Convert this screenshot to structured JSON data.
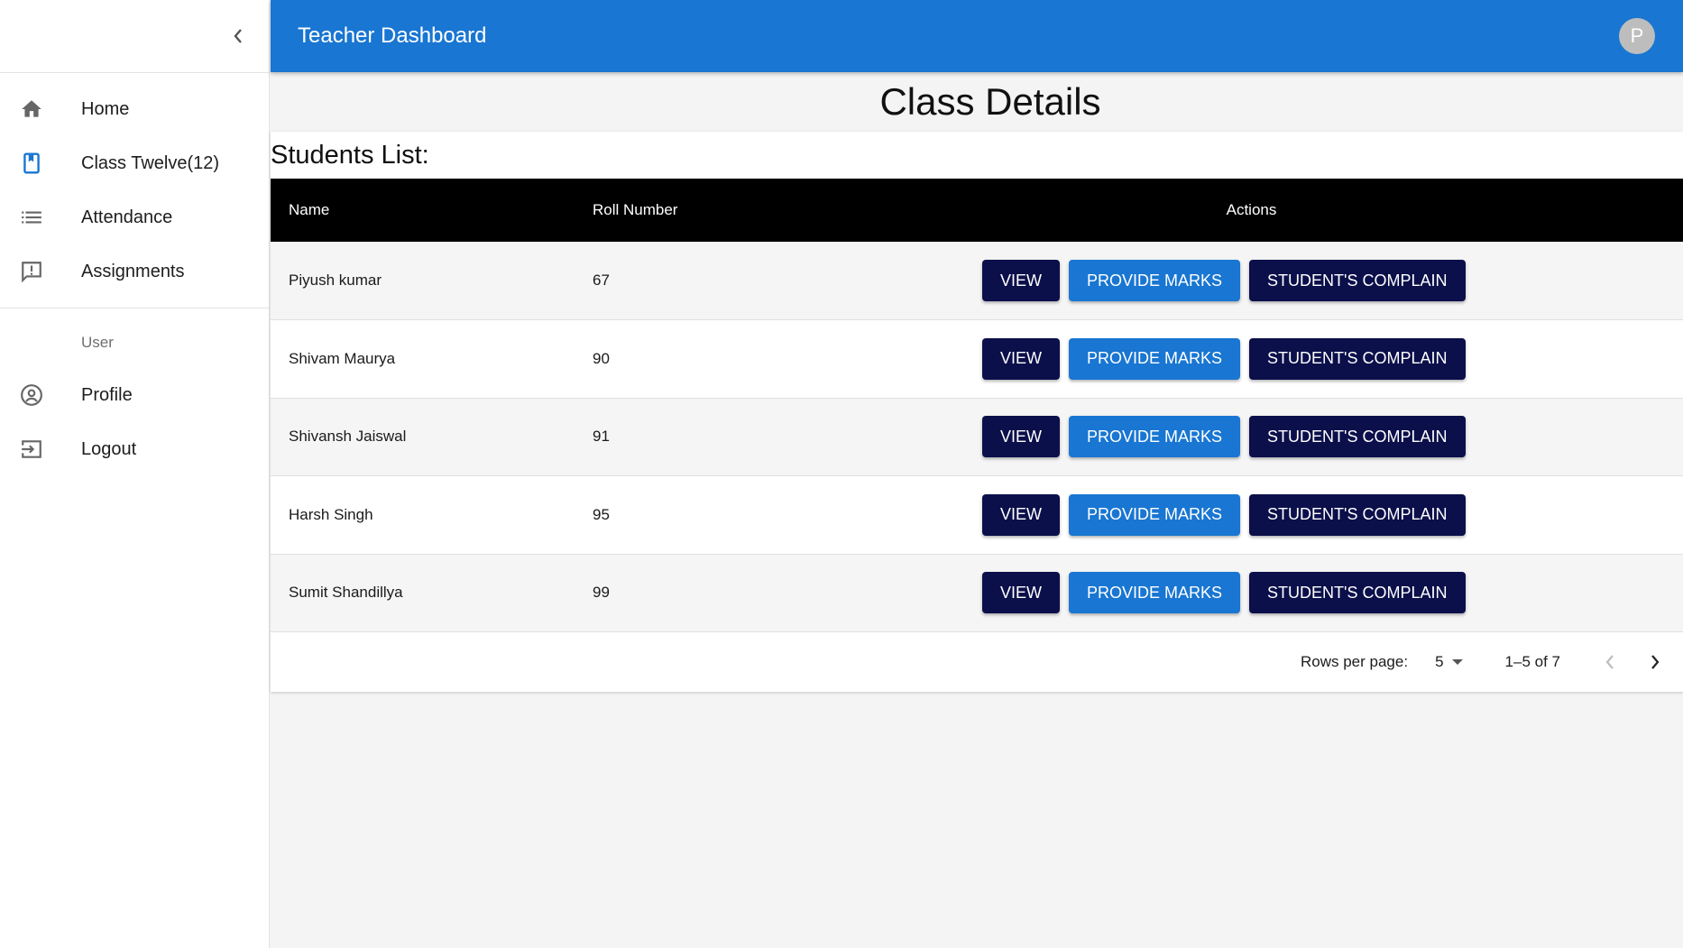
{
  "app": {
    "title": "Teacher Dashboard",
    "avatar_initial": "P"
  },
  "sidebar": {
    "items": [
      {
        "label": "Home",
        "icon": "home-icon"
      },
      {
        "label": "Class Twelve(12)",
        "icon": "class-icon"
      },
      {
        "label": "Attendance",
        "icon": "list-icon"
      },
      {
        "label": "Assignments",
        "icon": "feedback-icon"
      }
    ],
    "user_section_label": "User",
    "user_items": [
      {
        "label": "Profile",
        "icon": "account-circle-icon"
      },
      {
        "label": "Logout",
        "icon": "logout-icon"
      }
    ]
  },
  "main": {
    "page_title": "Class Details",
    "list_title": "Students List:",
    "columns": {
      "name": "Name",
      "roll": "Roll Number",
      "actions": "Actions"
    },
    "students": [
      {
        "name": "Piyush kumar",
        "roll": "67"
      },
      {
        "name": "Shivam Maurya",
        "roll": "90"
      },
      {
        "name": "Shivansh Jaiswal",
        "roll": "91"
      },
      {
        "name": "Harsh Singh",
        "roll": "95"
      },
      {
        "name": "Sumit Shandillya",
        "roll": "99"
      }
    ],
    "action_labels": {
      "view": "VIEW",
      "marks": "PROVIDE MARKS",
      "complain": "STUDENT'S COMPLAIN"
    },
    "pagination": {
      "rows_per_page_label": "Rows per page:",
      "rows_per_page_value": "5",
      "range": "1–5 of 7"
    }
  },
  "colors": {
    "appbar": "#1976d2",
    "dark_button": "#0b0f4a",
    "blue_button": "#1976d2",
    "header_row": "#000000"
  }
}
